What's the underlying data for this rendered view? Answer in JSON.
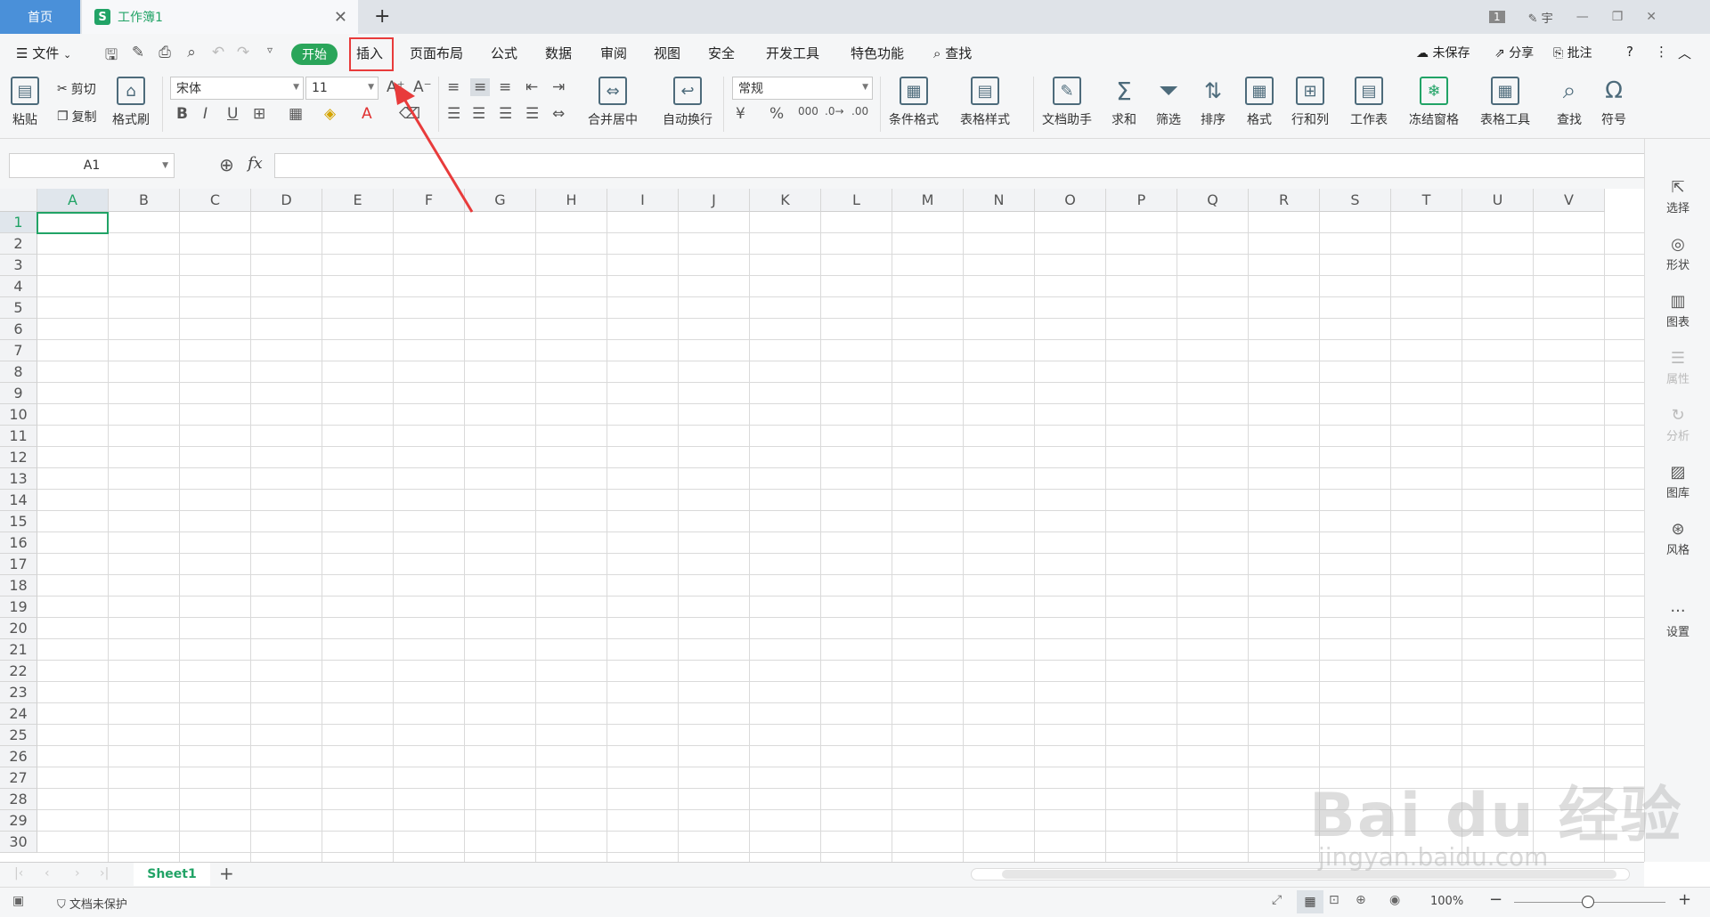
{
  "tabs": {
    "home": "首页",
    "doc": "工作簿1",
    "doc_logo": "S"
  },
  "window": {
    "badge": "1",
    "user": "宇"
  },
  "menu": {
    "file": "文件",
    "start": "开始",
    "insert": "插入",
    "page_layout": "页面布局",
    "formula": "公式",
    "data": "数据",
    "review": "审阅",
    "view": "视图",
    "security": "安全",
    "developer": "开发工具",
    "features": "特色功能",
    "search": "查找",
    "unsaved": "未保存",
    "share": "分享",
    "comment": "批注"
  },
  "ribbon": {
    "paste": "粘贴",
    "cut": "剪切",
    "copy": "复制",
    "format_painter": "格式刷",
    "font_name": "宋体",
    "font_size": "11",
    "merge_center": "合并居中",
    "wrap_text": "自动换行",
    "number_format": "常规",
    "conditional_format": "条件格式",
    "table_style": "表格样式",
    "doc_assistant": "文档助手",
    "sum": "求和",
    "filter": "筛选",
    "sort": "排序",
    "format": "格式",
    "row_col": "行和列",
    "worksheet": "工作表",
    "freeze": "冻结窗格",
    "table_tools": "表格工具",
    "find": "查找",
    "symbol": "符号"
  },
  "formula_bar": {
    "cell_ref": "A1",
    "fx": "fx"
  },
  "grid": {
    "columns": [
      "A",
      "B",
      "C",
      "D",
      "E",
      "F",
      "G",
      "H",
      "I",
      "J",
      "K",
      "L",
      "M",
      "N",
      "O",
      "P",
      "Q",
      "R",
      "S",
      "T",
      "U",
      "V"
    ],
    "rows": [
      "1",
      "2",
      "3",
      "4",
      "5",
      "6",
      "7",
      "8",
      "9",
      "10",
      "11",
      "12",
      "13",
      "14",
      "15",
      "16",
      "17",
      "18",
      "19",
      "20",
      "21",
      "22",
      "23",
      "24",
      "25",
      "26",
      "27",
      "28",
      "29",
      "30"
    ]
  },
  "right_panel": {
    "select": "选择",
    "shape": "形状",
    "chart": "图表",
    "property": "属性",
    "analysis": "分析",
    "gallery": "图库",
    "style": "风格",
    "settings": "设置"
  },
  "sheets": {
    "active": "Sheet1"
  },
  "status": {
    "protection": "文档未保护",
    "zoom": "100%"
  },
  "watermark": {
    "main": "Bai du 经验",
    "sub": "jingyan.baidu.com"
  },
  "colors": {
    "accent_green": "#21a366",
    "home_tab": "#4a90d9",
    "highlight_red": "#e83b3b"
  }
}
